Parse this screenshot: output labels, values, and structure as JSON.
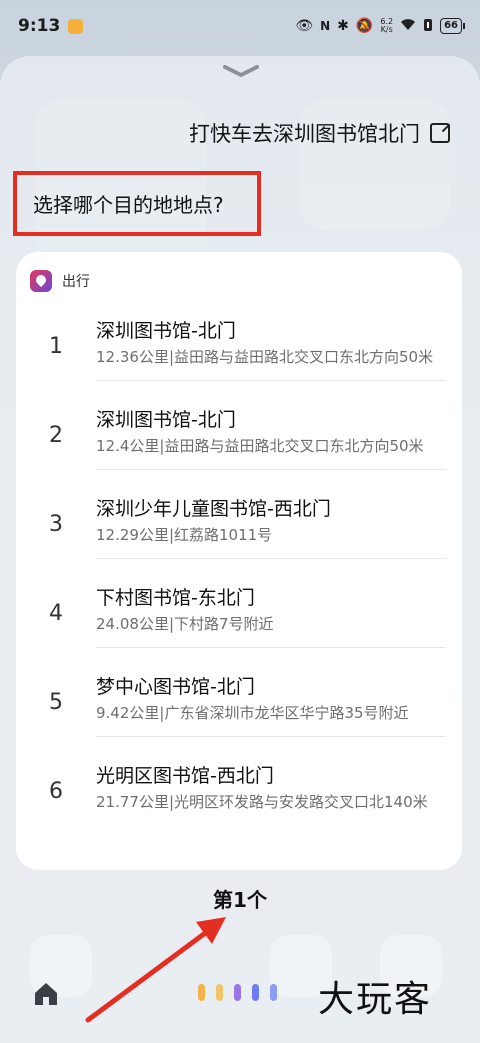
{
  "status_bar": {
    "time": "9:13",
    "network_speed_top": "6.2",
    "network_speed_bottom": "K/s",
    "battery": "66"
  },
  "assistant": {
    "query": "打快车去深圳图书馆北门",
    "question": "选择哪个目的地地点?"
  },
  "card": {
    "app_name": "出行",
    "items": [
      {
        "index": "1",
        "name": "深圳图书馆-北门",
        "detail": "12.36公里|益田路与益田路北交叉口东北方向50米"
      },
      {
        "index": "2",
        "name": "深圳图书馆-北门",
        "detail": "12.4公里|益田路与益田路北交叉口东北方向50米"
      },
      {
        "index": "3",
        "name": "深圳少年儿童图书馆-西北门",
        "detail": "12.29公里|红荔路1011号"
      },
      {
        "index": "4",
        "name": "下村图书馆-东北门",
        "detail": "24.08公里|下村路7号附近"
      },
      {
        "index": "5",
        "name": "梦中心图书馆-北门",
        "detail": "9.42公里|广东省深圳市龙华区华宁路35号附近"
      },
      {
        "index": "6",
        "name": "光明区图书馆-西北门",
        "detail": "21.77公里|光明区环发路与安发路交叉口北140米"
      }
    ]
  },
  "pager_label": "第1个",
  "watermark": "大玩客",
  "colors": {
    "highlight_box": "#e52e22",
    "arrow": "#e52e22",
    "voice_dots": [
      "#f4b24a",
      "#f3c36a",
      "#9b74e6",
      "#6e7cf0",
      "#8c9cf2"
    ]
  }
}
